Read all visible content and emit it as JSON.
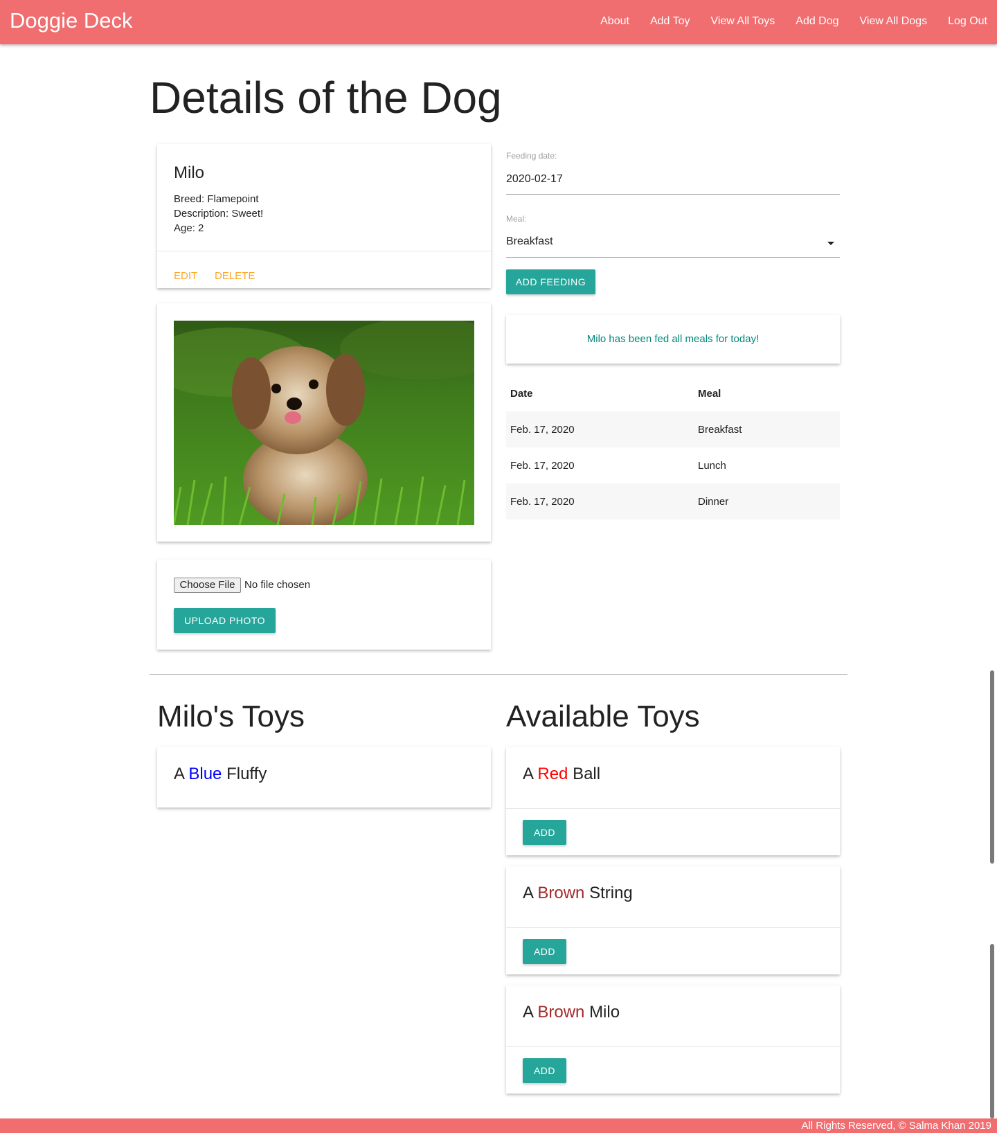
{
  "app": {
    "brand": "Doggie Deck"
  },
  "nav": {
    "items": [
      "About",
      "Add Toy",
      "View All Toys",
      "Add Dog",
      "View All Dogs",
      "Log Out"
    ]
  },
  "page": {
    "title": "Details of the Dog"
  },
  "dog": {
    "name": "Milo",
    "breed_line": "Breed: Flamepoint",
    "description_line": "Description: Sweet!",
    "age_line": "Age: 2",
    "edit_label": "EDIT",
    "delete_label": "DELETE"
  },
  "upload": {
    "choose_label": "Choose File",
    "file_status": "No file chosen",
    "button_label": "UPLOAD PHOTO"
  },
  "feeding_form": {
    "date_label": "Feeding date:",
    "date_value": "2020-02-17",
    "meal_label": "Meal:",
    "meal_value": "Breakfast",
    "button_label": "ADD FEEDING"
  },
  "fed_message": "Milo has been fed all meals for today!",
  "feedings": {
    "headers": [
      "Date",
      "Meal"
    ],
    "rows": [
      {
        "date": "Feb. 17, 2020",
        "meal": "Breakfast"
      },
      {
        "date": "Feb. 17, 2020",
        "meal": "Lunch"
      },
      {
        "date": "Feb. 17, 2020",
        "meal": "Dinner"
      }
    ]
  },
  "milos_toys": {
    "title": "Milo's Toys",
    "items": [
      {
        "prefix": "A",
        "color": "Blue",
        "color_hex": "#0000ff",
        "name": "Fluffy"
      }
    ]
  },
  "available_toys": {
    "title": "Available Toys",
    "add_label": "ADD",
    "items": [
      {
        "prefix": "A",
        "color": "Red",
        "color_hex": "#ff0000",
        "name": "Ball"
      },
      {
        "prefix": "A",
        "color": "Brown",
        "color_hex": "#a52a2a",
        "name": "String"
      },
      {
        "prefix": "A",
        "color": "Brown",
        "color_hex": "#a52a2a",
        "name": "Milo"
      }
    ]
  },
  "footer": {
    "text": "All Rights Reserved, © Salma Khan 2019"
  },
  "colors": {
    "nav": "#f06d70",
    "accent_teal": "#26a69a",
    "action_orange": "#ffa726",
    "fed_text": "#00897b"
  }
}
